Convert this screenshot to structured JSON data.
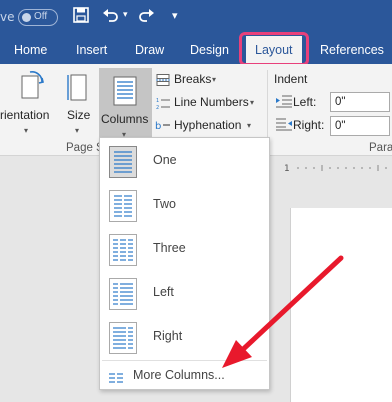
{
  "titlebar": {
    "autosave_partial": "ve",
    "autosave_toggle": "Off",
    "more_icon": "▾"
  },
  "tabs": [
    {
      "label": "Home"
    },
    {
      "label": "Insert"
    },
    {
      "label": "Draw"
    },
    {
      "label": "Design"
    },
    {
      "label": "Layout",
      "active": true
    },
    {
      "label": "References"
    }
  ],
  "ribbon": {
    "orientation_label": "rientation",
    "size_label": "Size",
    "columns_label": "Columns",
    "page_setup_group": "Page S",
    "breaks_label": "Breaks",
    "line_numbers_label": "Line Numbers",
    "hyphenation_label": "Hyphenation",
    "indent_heading": "Indent",
    "indent_left_label": "Left:",
    "indent_left_value": "0\"",
    "indent_right_label": "Right:",
    "indent_right_value": "0\"",
    "paragraph_group": "Para"
  },
  "columns_menu": {
    "items": [
      {
        "label": "One",
        "selected": true
      },
      {
        "label": "Two"
      },
      {
        "label": "Three"
      },
      {
        "label": "Left"
      },
      {
        "label": "Right"
      }
    ],
    "more": "More Columns..."
  },
  "colors": {
    "brand": "#2b579a",
    "highlight": "#e8407b",
    "arrow": "#e8192c"
  }
}
